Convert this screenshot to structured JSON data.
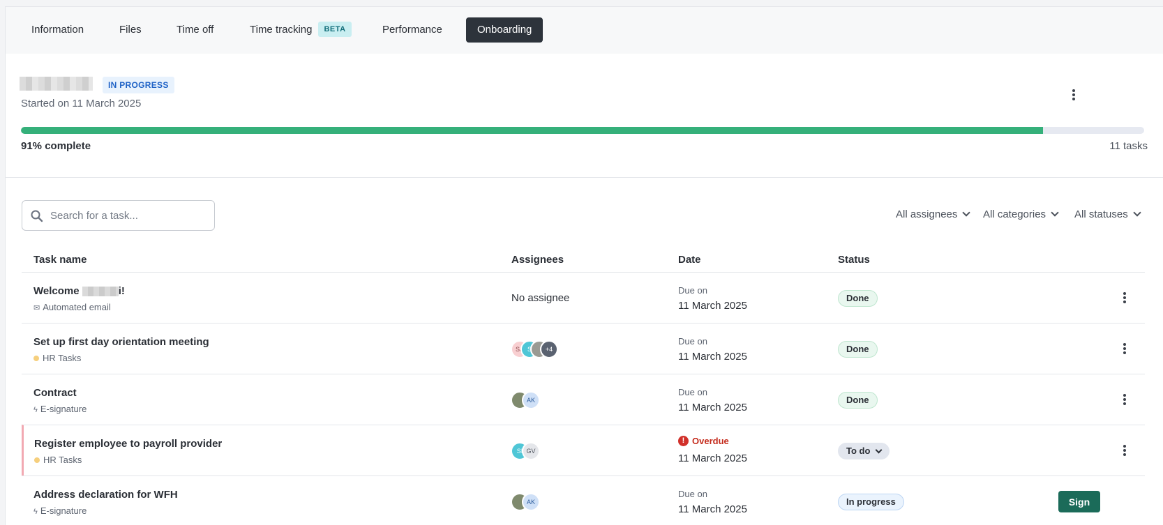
{
  "tabs": [
    {
      "label": "Information"
    },
    {
      "label": "Files"
    },
    {
      "label": "Time off"
    },
    {
      "label": "Time tracking",
      "badge": "BETA"
    },
    {
      "label": "Performance"
    },
    {
      "label": "Onboarding",
      "active": true
    }
  ],
  "onboarding": {
    "status": "IN PROGRESS",
    "started": "Started on 11 March 2025",
    "progress_fraction": 0.91,
    "progress_label": "91% complete",
    "task_count": "11 tasks"
  },
  "toolbar": {
    "search_placeholder": "Search for a task...",
    "filters": [
      "All assignees",
      "All categories",
      "All statuses"
    ]
  },
  "table": {
    "headers": [
      "Task name",
      "Assignees",
      "Date",
      "Status"
    ],
    "rows": [
      {
        "name_prefix": "Welcome ",
        "name_suffix": "i!",
        "category": "Automated email",
        "category_icon": "envelope-icon",
        "assignees_text": "No assignee",
        "due_label": "Due on",
        "date": "11 March 2025",
        "status": "Done"
      },
      {
        "name": "Set up first day orientation meeting",
        "category": "HR Tasks",
        "category_icon": "dot-icon",
        "avatars": [
          "SA",
          "S",
          "",
          "+4"
        ],
        "due_label": "Due on",
        "date": "11 March 2025",
        "status": "Done"
      },
      {
        "name": "Contract",
        "category": "E-signature",
        "category_icon": "bolt-icon",
        "avatars": [
          "",
          "AK"
        ],
        "due_label": "Due on",
        "date": "11 March 2025",
        "status": "Done"
      },
      {
        "name": "Register employee to payroll provider",
        "category": "HR Tasks",
        "category_icon": "dot-icon",
        "avatars": [
          "SI",
          "GV"
        ],
        "overdue_label": "Overdue",
        "date": "11 March 2025",
        "status": "To do"
      },
      {
        "name": "Address declaration for WFH",
        "category": "E-signature",
        "category_icon": "bolt-icon",
        "avatars": [
          "",
          "AK"
        ],
        "due_label": "Due on",
        "date": "11 March 2025",
        "status": "In progress",
        "action": "Sign"
      }
    ]
  },
  "colors": {
    "progress": "#35b07a",
    "active_tab": "#2d333b",
    "sign_button": "#1b6b59",
    "overdue": "#d1302a"
  }
}
